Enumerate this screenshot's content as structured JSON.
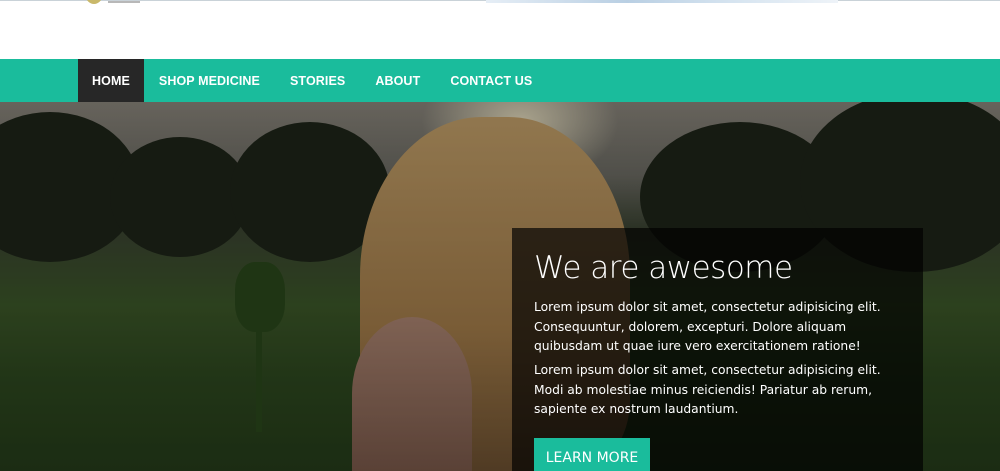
{
  "nav": {
    "items": [
      {
        "label": "HOME",
        "active": true
      },
      {
        "label": "SHOP MEDICINE",
        "active": false
      },
      {
        "label": "STORIES",
        "active": false
      },
      {
        "label": "ABOUT",
        "active": false
      },
      {
        "label": "CONTACT US",
        "active": false
      }
    ]
  },
  "hero": {
    "title": "We are awesome",
    "paragraph_1": "Lorem ipsum dolor sit amet, consectetur adipisicing elit. Consequuntur, dolorem, excepturi. Dolore aliquam quibusdam ut quae iure vero exercitationem ratione!",
    "paragraph_2": "Lorem ipsum dolor sit amet, consectetur adipisicing elit. Modi ab molestiae minus reiciendis! Pariatur ab rerum, sapiente ex nostrum laudantium.",
    "button_label": "LEARN MORE"
  },
  "colors": {
    "accent": "#1abc9c",
    "nav_active_bg": "#272727",
    "card_bg": "rgba(0,0,0,0.68)"
  }
}
